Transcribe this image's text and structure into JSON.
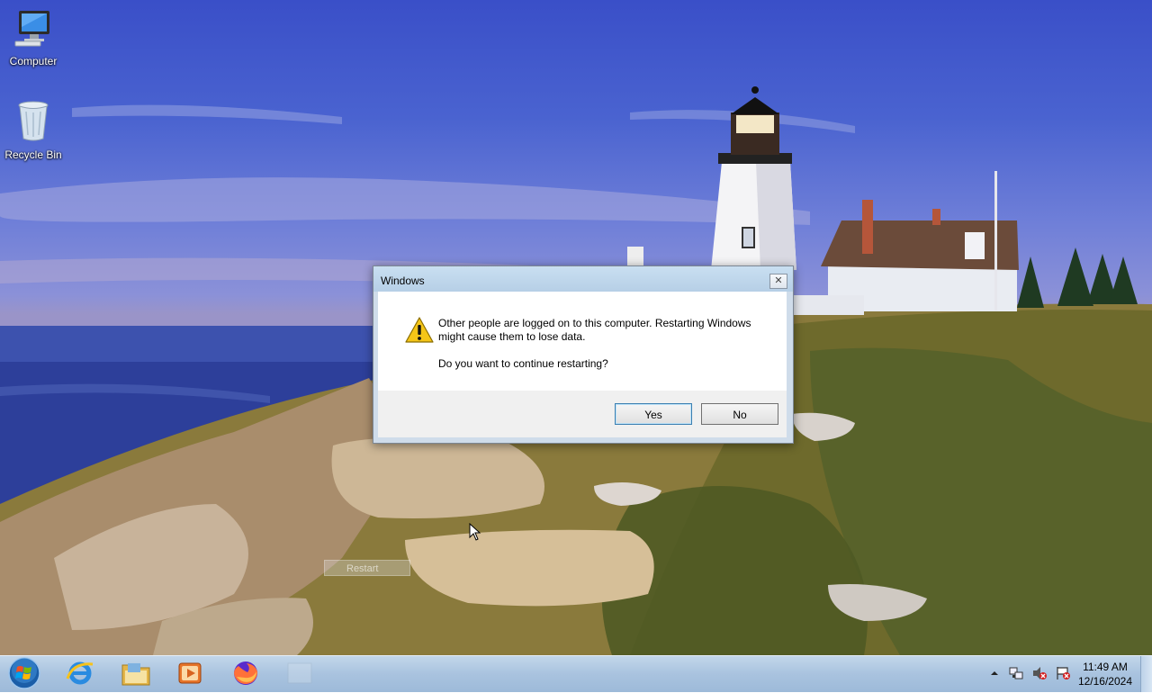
{
  "desktop": {
    "icons": [
      {
        "label": "Computer",
        "icon": "computer-icon"
      },
      {
        "label": "Recycle Bin",
        "icon": "recycle-bin-icon"
      }
    ],
    "ghost_label": "Restart"
  },
  "dialog": {
    "title": "Windows",
    "close_glyph": "✕",
    "message": "Other people are logged on to this computer. Restarting Windows might cause them to lose data.",
    "question": "Do you want to continue restarting?",
    "yes_label": "Yes",
    "no_label": "No",
    "icon": "warning-icon"
  },
  "taskbar": {
    "pinned": [
      {
        "name": "internet-explorer",
        "icon": "internet-explorer-icon"
      },
      {
        "name": "file-explorer",
        "icon": "folder-icon"
      },
      {
        "name": "media-player",
        "icon": "media-player-icon"
      },
      {
        "name": "firefox",
        "icon": "firefox-icon"
      }
    ],
    "tray_icons": [
      "show-hidden-icons-arrow",
      "network-icon",
      "volume-muted-icon",
      "action-center-icon"
    ],
    "time": "11:49 AM",
    "date": "12/16/2024"
  },
  "colors": {
    "taskbar": "#a9c3df",
    "dialog_titlebar": "#c9dff1",
    "default_button_border": "#3c7fb1"
  }
}
